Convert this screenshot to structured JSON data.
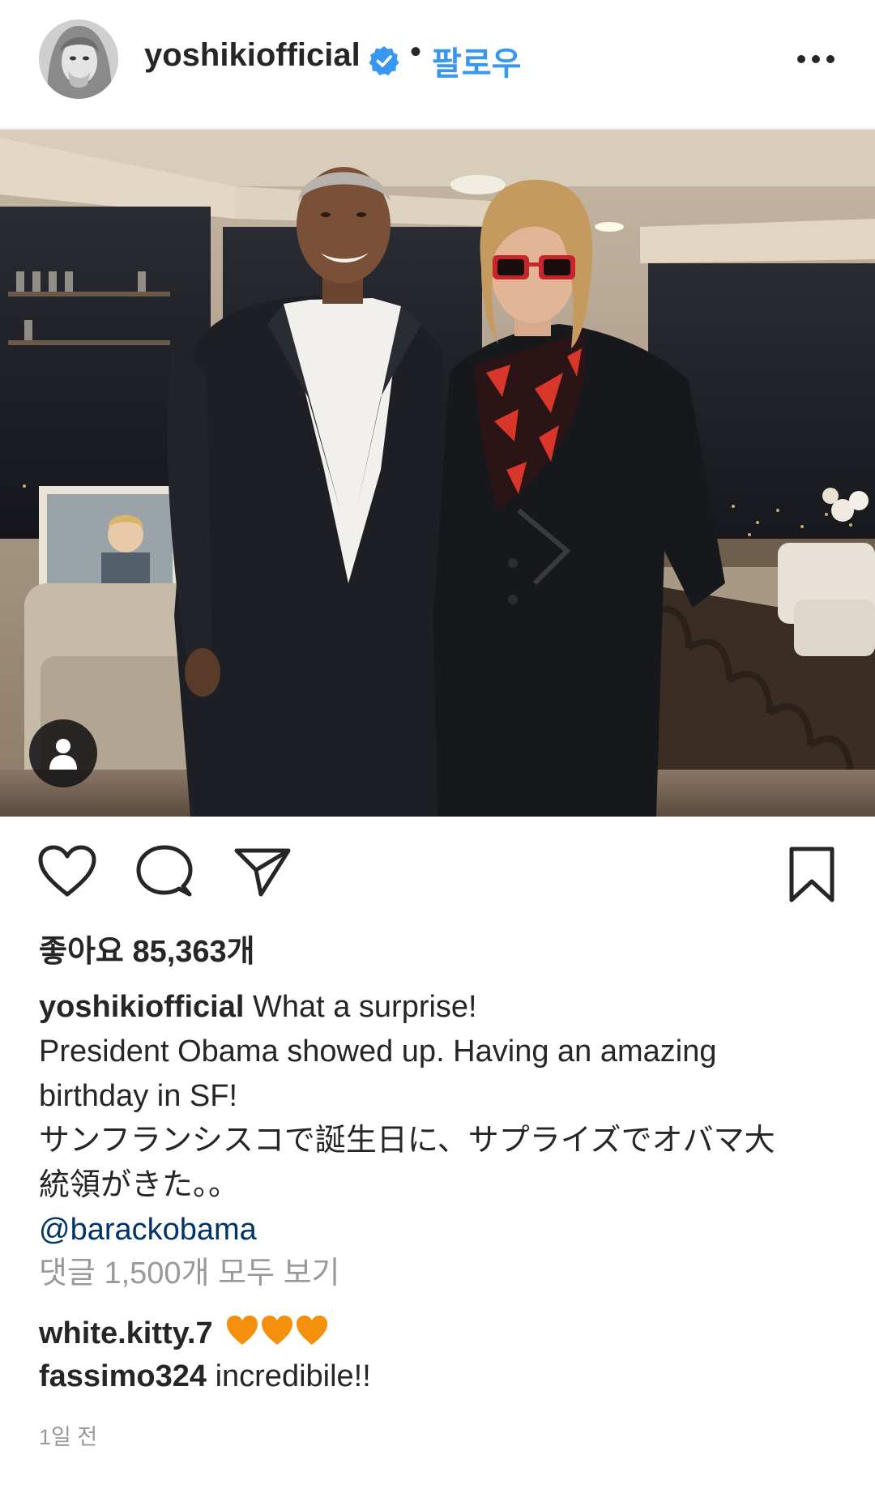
{
  "header": {
    "username": "yoshikiofficial",
    "separator": "•",
    "follow_label": "팔로우",
    "icons": [
      "profile-avatar",
      "verified-badge-icon",
      "more-options-icon"
    ]
  },
  "photo": {
    "icons": [
      "tag-user-icon"
    ]
  },
  "actions": {
    "icons": [
      "heart-icon",
      "comment-icon",
      "share-icon",
      "bookmark-icon"
    ]
  },
  "likes": {
    "text": "좋아요 85,363개"
  },
  "caption": {
    "username": "yoshikiofficial",
    "first_line": " What a surprise!",
    "line2": "President Obama showed up. Having an amazing",
    "line3": "birthday in SF!",
    "line4": "サンフランシスコで誕生日に、サプライズでオバマ大",
    "line5": "統領がきた。。",
    "mention": "@barackobama"
  },
  "view_comments": "댓글 1,500개 모두 보기",
  "comments": [
    {
      "username": "white.kitty.7",
      "text": " ",
      "emoji": "🧡🧡🧡"
    },
    {
      "username": "fassimo324",
      "text": " incredibile!!"
    }
  ],
  "timestamp": "1일 전",
  "colors": {
    "link_blue": "#3897f0",
    "mention_navy": "#003569",
    "muted_gray": "#999999",
    "text": "#262626",
    "heart_orange": "#f4900c"
  }
}
